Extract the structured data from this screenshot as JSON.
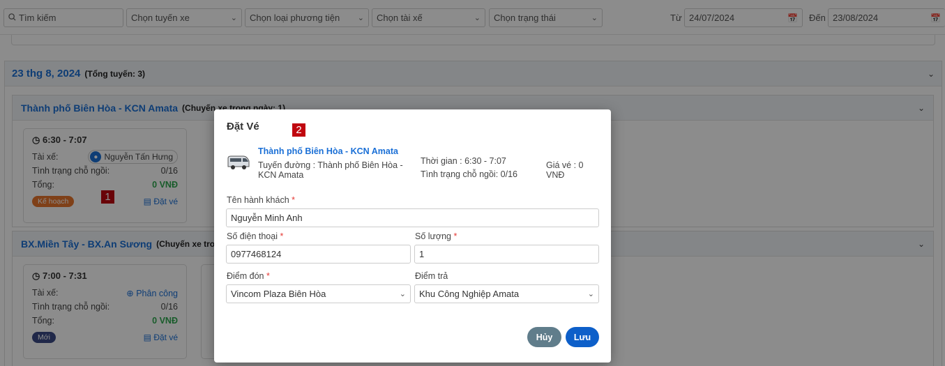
{
  "filters": {
    "search_placeholder": "Tìm kiếm",
    "route_select": "Chọn tuyến xe",
    "vehicle_type_select": "Chọn loại phương tiện",
    "driver_select": "Chọn tài xế",
    "status_select": "Chọn trạng thái",
    "from_label": "Từ",
    "from_date": "24/07/2024",
    "to_label": "Đến",
    "to_date": "23/08/2024"
  },
  "date_group": {
    "title": "23 thg 8, 2024",
    "subtitle": "(Tổng tuyến: 3)"
  },
  "routes": [
    {
      "title": "Thành phố Biên Hòa - KCN Amata",
      "subtitle": "(Chuyến xe trong ngày: 1)",
      "trips": [
        {
          "time": "6:30  -  7:07",
          "driver_label": "Tài xế:",
          "driver_name": "Nguyễn Tấn Hưng",
          "seat_label": "Tình trạng chỗ ngồi:",
          "seat_value": "0/16",
          "total_label": "Tổng:",
          "total_value": "0 VNĐ",
          "status": "Kế hoạch",
          "book_label": "Đặt vé"
        }
      ]
    },
    {
      "title": "BX.Miền Tây - BX.An Sương",
      "subtitle": "(Chuyến xe tro",
      "trips": [
        {
          "time": "7:00  -  7:31",
          "driver_label": "Tài xế:",
          "assign_label": "Phân công",
          "seat_label": "Tình trạng chỗ ngồi:",
          "seat_value": "0/16",
          "total_label": "Tổng:",
          "total_value": "0 VNĐ",
          "status": "Mới",
          "book_label": "Đặt vé"
        }
      ]
    }
  ],
  "markers": [
    "1",
    "2"
  ],
  "modal": {
    "title": "Đặt Vé",
    "trip_route": "Thành phố Biên Hòa - KCN Amata",
    "trip_line": "Tuyến đường : Thành phố Biên Hòa - KCN Amata",
    "trip_time": "Thời gian : 6:30 - 7:07",
    "trip_seats": "Tình trạng chỗ ngồi: 0/16",
    "trip_price": "Giá vé : 0 VNĐ",
    "passenger_label": "Tên hành khách",
    "passenger_value": "Nguyễn Minh Anh",
    "phone_label": "Số điện thoại",
    "phone_value": "0977468124",
    "quantity_label": "Số lượng",
    "quantity_value": "1",
    "pickup_label": "Điểm đón",
    "pickup_value": "Vincom Plaza Biên Hòa",
    "dropoff_label": "Điểm trả",
    "dropoff_value": "Khu Công Nghiệp Amata",
    "required_mark": "*",
    "cancel_label": "Hủy",
    "save_label": "Lưu"
  },
  "colors": {
    "primary": "#1a6fd6",
    "success": "#2fa84f",
    "status_plan": "#e8762c",
    "status_new": "#3b4a85",
    "marker": "#c0070f"
  }
}
